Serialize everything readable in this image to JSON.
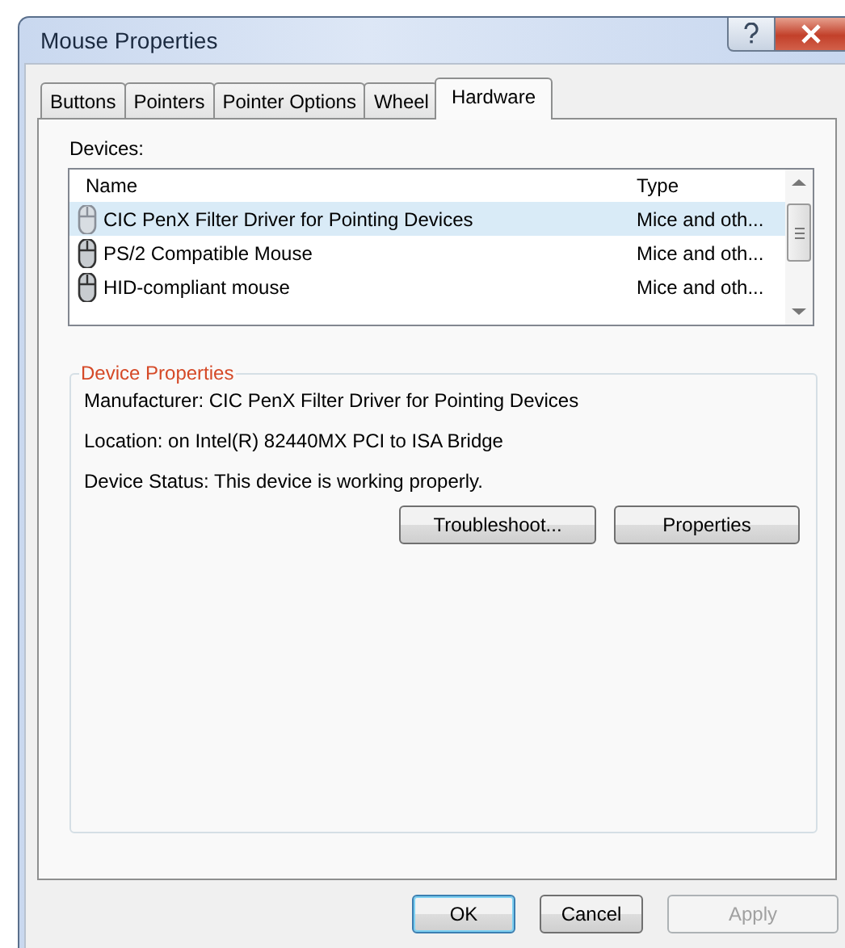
{
  "window": {
    "title": "Mouse Properties"
  },
  "tabs": [
    {
      "label": "Buttons",
      "selected": false
    },
    {
      "label": "Pointers",
      "selected": false
    },
    {
      "label": "Pointer Options",
      "selected": false
    },
    {
      "label": "Wheel",
      "selected": false
    },
    {
      "label": "Hardware",
      "selected": true
    }
  ],
  "devices": {
    "label": "Devices:",
    "columns": [
      "Name",
      "Type"
    ],
    "rows": [
      {
        "name": "CIC PenX Filter Driver for Pointing Devices",
        "type": "Mice and oth...",
        "selected": true
      },
      {
        "name": "PS/2 Compatible Mouse",
        "type": "Mice and oth...",
        "selected": false
      },
      {
        "name": "HID-compliant mouse",
        "type": "Mice and oth...",
        "selected": false
      }
    ]
  },
  "device_properties": {
    "title": "Device Properties",
    "lines": [
      "Manufacturer: CIC PenX Filter Driver for Pointing Devices",
      "Location: on Intel(R) 82440MX PCI to ISA Bridge",
      "Device Status: This device is working properly."
    ],
    "buttons": [
      "Troubleshoot...",
      "Properties"
    ]
  },
  "buttons": [
    {
      "label": "OK",
      "disabled": false,
      "default": true
    },
    {
      "label": "Cancel",
      "disabled": false,
      "default": false
    },
    {
      "label": "Apply",
      "disabled": true,
      "default": false
    }
  ]
}
